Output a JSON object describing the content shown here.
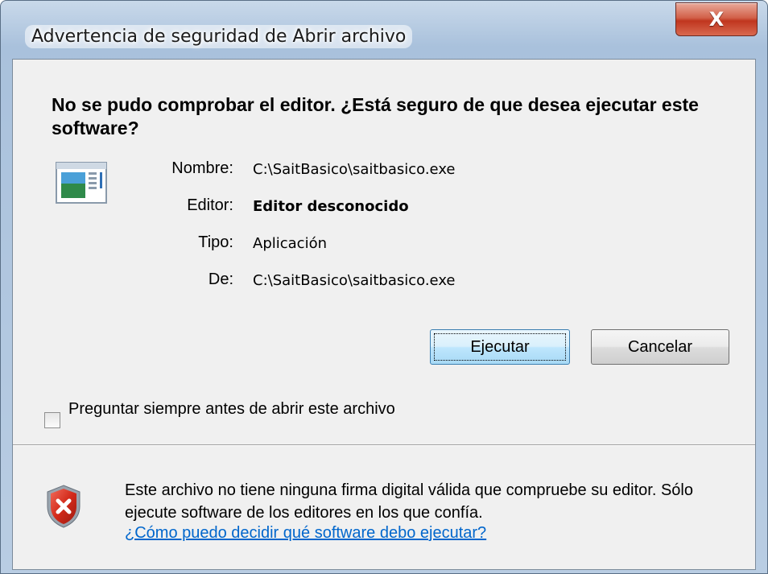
{
  "window": {
    "title": "Advertencia de seguridad de Abrir archivo",
    "close_glyph": "X"
  },
  "dialog": {
    "headline": "No se pudo comprobar el editor. ¿Está seguro de que desea ejecutar este software?",
    "fields": [
      {
        "label": "Nombre:",
        "value": "C:\\SaitBasico\\saitbasico.exe",
        "bold": false
      },
      {
        "label": "Editor:",
        "value": "Editor desconocido",
        "bold": true
      },
      {
        "label": "Tipo:",
        "value": "Aplicación",
        "bold": false
      },
      {
        "label": "De:",
        "value": "C:\\SaitBasico\\saitbasico.exe",
        "bold": false
      }
    ],
    "buttons": {
      "run_label": "Ejecutar",
      "cancel_label": "Cancelar"
    },
    "checkbox": {
      "label": "Preguntar siempre antes de abrir este archivo",
      "checked": false
    },
    "footer": {
      "warning_text": "Este archivo no tiene ninguna firma digital válida que compruebe su editor. Sólo ejecute software de los editores en los que confía.",
      "help_link": "¿Cómo puedo decidir qué software debo ejecutar?"
    }
  },
  "icons": {
    "app": "application-icon",
    "shield": "security-shield-error-icon"
  },
  "colors": {
    "link": "#0066cc",
    "close_button": "#c0361f",
    "shield_red": "#c4281c",
    "client_bg": "#f0f0f0"
  }
}
